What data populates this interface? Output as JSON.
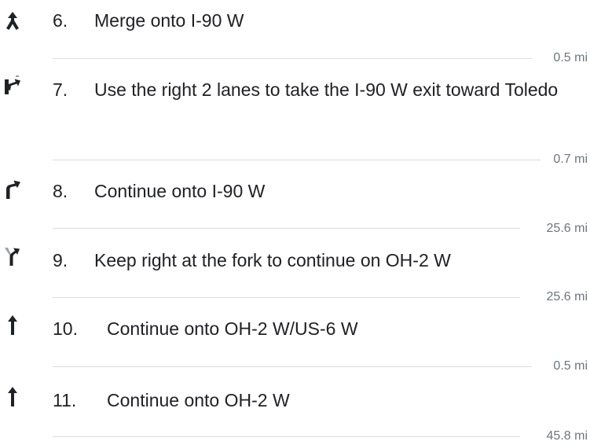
{
  "steps": [
    {
      "number": "6.",
      "instruction": "Merge onto I-90 W",
      "icon": "merge-icon",
      "distance": "0.5 mi"
    },
    {
      "number": "7.",
      "instruction": "Use the right 2 lanes to take the I-90 W exit toward Toledo",
      "icon": "ramp-right-icon",
      "distance": "0.7 mi"
    },
    {
      "number": "8.",
      "instruction": "Continue onto I-90 W",
      "icon": "turn-slight-right-icon",
      "distance": "25.6 mi"
    },
    {
      "number": "9.",
      "instruction": "Keep right at the fork to continue on OH-2 W",
      "icon": "fork-right-icon",
      "distance": "25.6 mi"
    },
    {
      "number": "10.",
      "instruction": "Continue onto OH-2 W/US-6 W",
      "icon": "straight-icon",
      "distance": "0.5 mi"
    },
    {
      "number": "11.",
      "instruction": "Continue onto OH-2 W",
      "icon": "straight-icon",
      "distance": "45.8 mi"
    }
  ],
  "colors": {
    "text": "#202124",
    "icon": "#202124",
    "divider": "#dadce0",
    "distance": "#70757a"
  }
}
